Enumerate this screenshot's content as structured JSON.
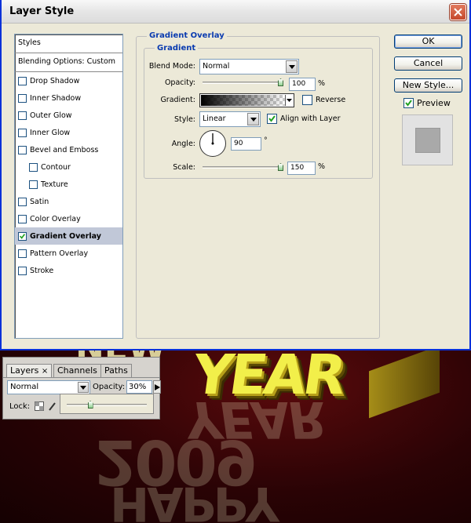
{
  "dialog": {
    "title": "Layer Style",
    "close_icon": "close-icon"
  },
  "styles_list": {
    "header": "Styles",
    "blending": "Blending Options: Custom",
    "items": [
      {
        "label": "Drop Shadow",
        "checked": false,
        "indent": false,
        "selected": false
      },
      {
        "label": "Inner Shadow",
        "checked": false,
        "indent": false,
        "selected": false
      },
      {
        "label": "Outer Glow",
        "checked": false,
        "indent": false,
        "selected": false
      },
      {
        "label": "Inner Glow",
        "checked": false,
        "indent": false,
        "selected": false
      },
      {
        "label": "Bevel and Emboss",
        "checked": false,
        "indent": false,
        "selected": false
      },
      {
        "label": "Contour",
        "checked": false,
        "indent": true,
        "selected": false
      },
      {
        "label": "Texture",
        "checked": false,
        "indent": true,
        "selected": false
      },
      {
        "label": "Satin",
        "checked": false,
        "indent": false,
        "selected": false
      },
      {
        "label": "Color Overlay",
        "checked": false,
        "indent": false,
        "selected": false
      },
      {
        "label": "Gradient Overlay",
        "checked": true,
        "indent": false,
        "selected": true
      },
      {
        "label": "Pattern Overlay",
        "checked": false,
        "indent": false,
        "selected": false
      },
      {
        "label": "Stroke",
        "checked": false,
        "indent": false,
        "selected": false
      }
    ]
  },
  "gradient_overlay": {
    "group_title": "Gradient Overlay",
    "sub_title": "Gradient",
    "blend_mode_label": "Blend Mode:",
    "blend_mode_value": "Normal",
    "opacity_label": "Opacity:",
    "opacity_value": "100",
    "opacity_fraction": 1.0,
    "percent": "%",
    "gradient_label": "Gradient:",
    "reverse_label": "Reverse",
    "reverse_checked": false,
    "style_label": "Style:",
    "style_value": "Linear",
    "align_label": "Align with Layer",
    "align_checked": true,
    "angle_label": "Angle:",
    "angle_value": "90",
    "angle_unit": "°",
    "scale_label": "Scale:",
    "scale_value": "150",
    "scale_fraction": 1.0
  },
  "buttons": {
    "ok": "OK",
    "cancel": "Cancel",
    "new_style": "New Style...",
    "preview": "Preview",
    "preview_checked": true
  },
  "layers_panel": {
    "tabs": [
      "Layers",
      "Channels",
      "Paths"
    ],
    "active_tab": "Layers",
    "blend_mode": "Normal",
    "opacity_label": "Opacity:",
    "opacity_value": "30%",
    "opacity_fraction": 0.3,
    "lock_label": "Lock:"
  },
  "colors": {
    "accent_title": "#0a3bb0",
    "selected_row": "#c1c8d8",
    "canvas_bg": "#2a0305",
    "art_yellow": "#f2ef4a"
  },
  "artwork": {
    "top_text": "YEAR",
    "top_text_partial": "NEW",
    "reflection_1": "YEAR",
    "reflection_2": "2009",
    "reflection_3": "HAPPY"
  }
}
